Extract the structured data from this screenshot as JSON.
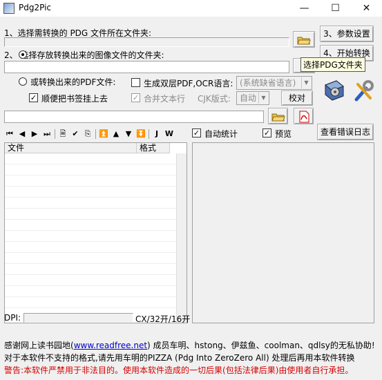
{
  "window": {
    "title": "Pdg2Pic",
    "minimize": "—",
    "maximize": "☐",
    "close": "✕"
  },
  "step1": {
    "label": "1、选择需转换的 PDG 文件所在文件夹:",
    "path_value": ""
  },
  "step2": {
    "label": "2、 选择存放转换出来的图像文件的文件夹:",
    "path_value": ""
  },
  "buttons": {
    "params": "3、参数设置",
    "start": "4、开始转换",
    "proofread": "校对",
    "view_log": "查看错误日志"
  },
  "tooltip": "选择PDG文件夹",
  "pdf": {
    "radio_label": "或转换出来的PDF文件:",
    "bookmark_label": "顺便把书签挂上去",
    "double_layer_label": "生成双层PDF,OCR语言:",
    "ocr_lang_value": "(系统缺省语言)",
    "merge_label": "合并文本行",
    "cjk_label": "CJK版式:",
    "cjk_value": "自动",
    "path_value": ""
  },
  "toolbar": {
    "icons": [
      "first-page-icon",
      "prev-page-icon",
      "next-page-icon",
      "last-page-icon",
      "page-icon",
      "check-icon",
      "export-icon",
      "top-icon",
      "up-icon",
      "down-icon",
      "bottom-icon",
      "J",
      "W"
    ],
    "auto_stat_label": "自动统计",
    "preview_label": "预览"
  },
  "file_list": {
    "col_file": "文件",
    "col_format": "格式"
  },
  "statusbar": {
    "dpi_label": "DPI:",
    "dpi_value": "",
    "size_label": "CX/32开/16开"
  },
  "footer": {
    "line1_prefix": "感谢网上读书园地(",
    "line1_link": "www.readfree.net",
    "line1_suffix": ") 成员车明、hstong、伊兹鱼、coolman、qdlsy的无私协助!",
    "line2": "对于本软件不支持的格式,请先用车明的PIZZA (Pdg Into ZeroZero All) 处理后再用本软件转换",
    "line3": "警告:本软件严禁用于非法目的。使用本软件造成的一切后果(包括法律后果)由使用者自行承担。"
  },
  "colors": {
    "warning": "#d40000",
    "link": "#0000cc"
  }
}
